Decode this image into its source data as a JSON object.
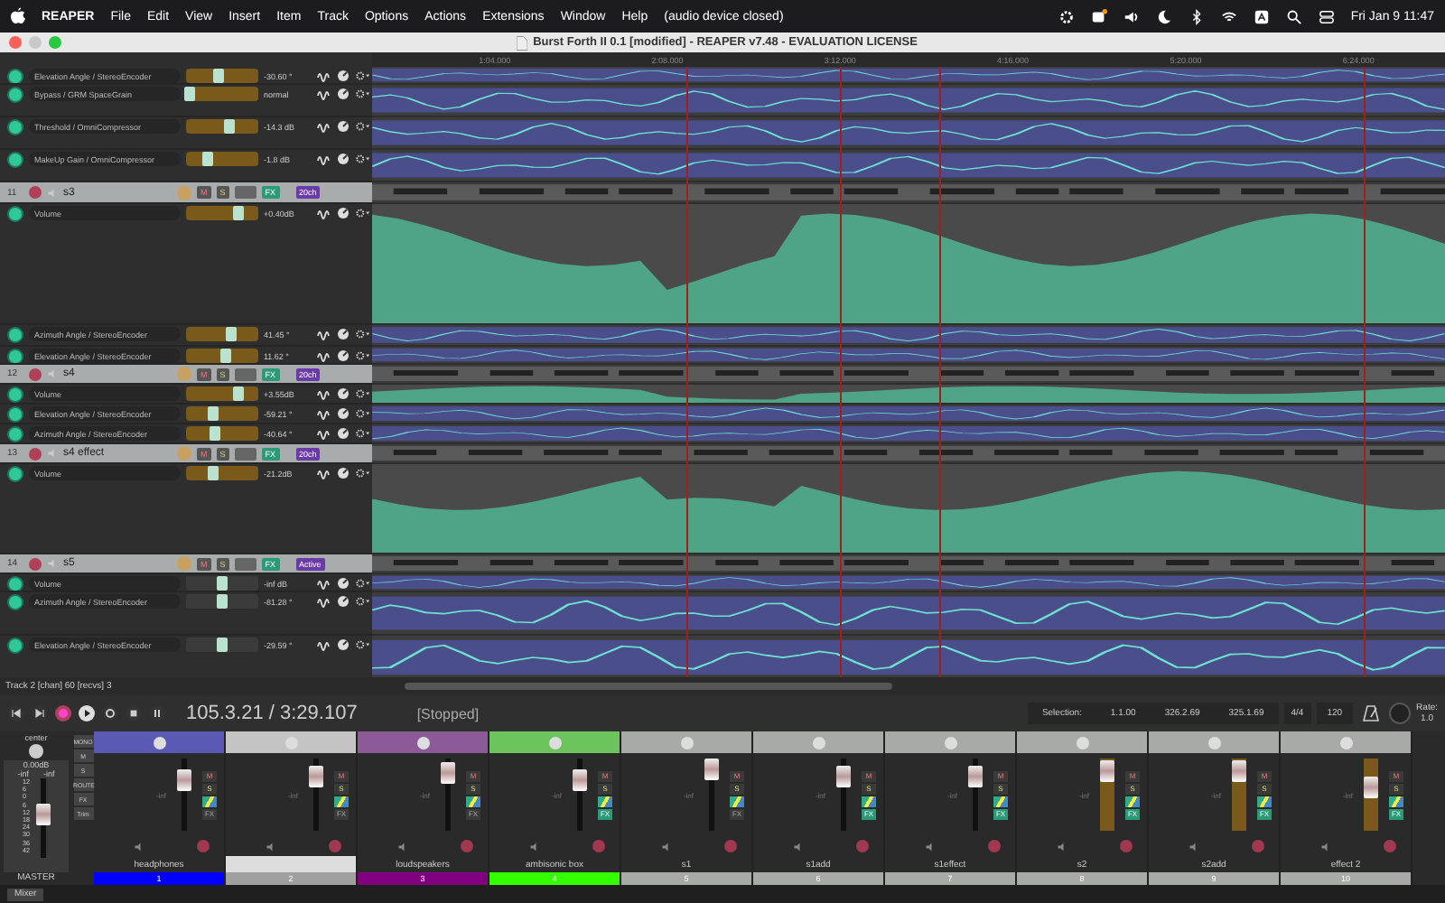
{
  "menubar": {
    "app": "REAPER",
    "menus": [
      "File",
      "Edit",
      "View",
      "Insert",
      "Item",
      "Track",
      "Options",
      "Actions",
      "Extensions",
      "Window",
      "Help",
      "(audio device closed)"
    ],
    "clock": "Fri Jan 9  11:47"
  },
  "window": {
    "title": "Burst Forth II 0.1 [modified] - REAPER v7.48 - EVALUATION LICENSE"
  },
  "ruler": {
    "labels": [
      "1:04.000",
      "2:08.000",
      "3:12.000",
      "4:16.000",
      "5:20.000",
      "6:24.000"
    ]
  },
  "tracks_panel": {
    "rows": [
      {
        "kind": "envelope",
        "name": "Elevation Angle / StereoEncoder",
        "value": "-30.60 °",
        "on": true,
        "armed": true,
        "level": 0.45
      },
      {
        "kind": "envelope",
        "name": "Bypass / GRM SpaceGrain",
        "value": "normal",
        "on": true,
        "armed": true,
        "level": 0.05
      },
      {
        "kind": "envelope",
        "name": "Threshold / OmniCompressor",
        "value": "-14.3 dB",
        "on": true,
        "armed": true,
        "level": 0.6
      },
      {
        "kind": "envelope",
        "name": "MakeUp Gain / OmniCompressor",
        "value": "-1.8 dB",
        "on": true,
        "armed": true,
        "level": 0.3
      },
      {
        "kind": "track",
        "number": "11",
        "name": "s3",
        "mute": "M",
        "solo": "S",
        "fx": "FX",
        "io": "20ch"
      },
      {
        "kind": "volume_envelope",
        "name": "Volume",
        "value": "+0.40dB",
        "on": true,
        "armed": true,
        "level": 0.72
      },
      {
        "kind": "envelope",
        "name": "Azimuth Angle / StereoEncoder",
        "value": "41.45 °",
        "on": true,
        "armed": true,
        "level": 0.62
      },
      {
        "kind": "envelope",
        "name": "Elevation Angle / StereoEncoder",
        "value": "11.62 °",
        "on": true,
        "armed": true,
        "level": 0.55
      },
      {
        "kind": "track",
        "number": "12",
        "name": "s4",
        "mute": "M",
        "solo": "S",
        "fx": "FX",
        "io": "20ch"
      },
      {
        "kind": "volume_envelope",
        "name": "Volume",
        "value": "+3.55dB",
        "on": true,
        "armed": true,
        "level": 0.72
      },
      {
        "kind": "envelope",
        "name": "Elevation Angle / StereoEncoder",
        "value": "-59.21 °",
        "on": true,
        "armed": true,
        "level": 0.38
      },
      {
        "kind": "envelope",
        "name": "Azimuth Angle / StereoEncoder",
        "value": "-40.64 °",
        "on": true,
        "armed": true,
        "level": 0.4
      },
      {
        "kind": "track",
        "number": "13",
        "name": "s4 effect",
        "mute": "M",
        "solo": "S",
        "fx": "FX",
        "io": "20ch"
      },
      {
        "kind": "volume_envelope",
        "name": "Volume",
        "value": "-21.2dB",
        "on": true,
        "armed": true,
        "level": 0.38
      },
      {
        "kind": "track",
        "number": "14",
        "name": "s5",
        "mute": "M",
        "solo": "S",
        "fx": "FX",
        "io": "Active"
      },
      {
        "kind": "envelope",
        "name": "Volume",
        "value": "-inf dB",
        "on": true,
        "armed": false,
        "level": 0.5
      },
      {
        "kind": "envelope",
        "name": "Azimuth Angle / StereoEncoder",
        "value": "-81.28 °",
        "on": true,
        "armed": false,
        "level": 0.5
      },
      {
        "kind": "envelope",
        "name": "Elevation Angle / StereoEncoder",
        "value": "-29.59 °",
        "on": true,
        "armed": false,
        "level": 0.5
      }
    ]
  },
  "status_line": "Track 2 [chan] 60 [recvs] 3",
  "transport": {
    "position": "105.3.21 / 3:29.107",
    "state": "[Stopped]",
    "selection_label": "Selection:",
    "selection": [
      "1.1.00",
      "326.2.69",
      "325.1.69"
    ],
    "time_signature": "4/4",
    "tempo": "120",
    "rate_label": "Rate:",
    "rate": "1.0"
  },
  "mixer": {
    "master": {
      "pan_label": "center",
      "volume": "0.00dB",
      "peaks": [
        "-inf",
        "-inf"
      ],
      "scale": [
        "12",
        "6",
        "0",
        "6",
        "12",
        "18",
        "24",
        "30",
        "36",
        "42"
      ],
      "name": "MASTER",
      "level": 0.55,
      "side_buttons": [
        "MONO",
        "M",
        "S",
        "ROUTE",
        "FX",
        "Trim"
      ]
    },
    "strips": [
      {
        "color": "#5a5ab4",
        "readout": "-inf",
        "mute": "M",
        "solo": "S",
        "fx": "FX",
        "level": 0.7,
        "armed": false,
        "fx_on": false,
        "name": "headphones",
        "number_bar": {
          "label": "1",
          "color": "#0000ff"
        }
      },
      {
        "color": "#c4c4c4",
        "readout": "-inf",
        "mute": "M",
        "solo": "S",
        "fx": "FX",
        "level": 0.75,
        "armed": false,
        "fx_on": false,
        "number_bar": {
          "label": "2",
          "color": "#a0a0a0"
        }
      },
      {
        "color": "#8c5a96",
        "readout": "-inf",
        "mute": "M",
        "solo": "S",
        "fx": "FX",
        "level": 0.8,
        "armed": false,
        "fx_on": false,
        "name": "loudspeakers",
        "number_bar": {
          "label": "3",
          "color": "#800080"
        }
      },
      {
        "color": "#6cc45c",
        "readout": "-inf",
        "mute": "M",
        "solo": "S",
        "fx": "FX",
        "level": 0.7,
        "armed": false,
        "fx_on": true,
        "name": "ambisonic box",
        "number_bar": {
          "label": "4",
          "color": "#33ff00"
        }
      },
      {
        "color": "#a8aaa8",
        "readout": "-inf",
        "mute": "M",
        "solo": "S",
        "fx": "FX",
        "level": 0.85,
        "armed": false,
        "fx_on": false,
        "name": "s1",
        "number_bar": {
          "label": "5",
          "color": "#a8aaa8"
        }
      },
      {
        "color": "#a8aaa8",
        "readout": "-inf",
        "mute": "M",
        "solo": "S",
        "fx": "FX",
        "level": 0.75,
        "armed": false,
        "fx_on": true,
        "name": "s1add",
        "number_bar": {
          "label": "6",
          "color": "#a8aaa8"
        }
      },
      {
        "color": "#a8aaa8",
        "readout": "-inf",
        "mute": "M",
        "solo": "S",
        "fx": "FX",
        "level": 0.75,
        "armed": false,
        "fx_on": true,
        "name": "s1effect",
        "number_bar": {
          "label": "7",
          "color": "#a8aaa8"
        }
      },
      {
        "color": "#a8aaa8",
        "readout": "-inf",
        "mute": "M",
        "solo": "S",
        "fx": "FX",
        "level": 0.82,
        "armed": true,
        "fx_on": true,
        "name": "s2",
        "number_bar": {
          "label": "8",
          "color": "#a8aaa8"
        }
      },
      {
        "color": "#a8aaa8",
        "readout": "-inf",
        "mute": "M",
        "solo": "S",
        "fx": "FX",
        "level": 0.82,
        "armed": true,
        "fx_on": true,
        "name": "s2add",
        "number_bar": {
          "label": "9",
          "color": "#a8aaa8"
        }
      },
      {
        "color": "#a8aaa8",
        "readout": "-inf",
        "mute": "M",
        "solo": "S",
        "fx": "FX",
        "level": 0.6,
        "armed": true,
        "fx_on": true,
        "name": "effect 2",
        "number_bar": {
          "label": "10",
          "color": "#a8aaa8"
        }
      }
    ]
  },
  "dock_tab": {
    "label": "Mixer"
  }
}
